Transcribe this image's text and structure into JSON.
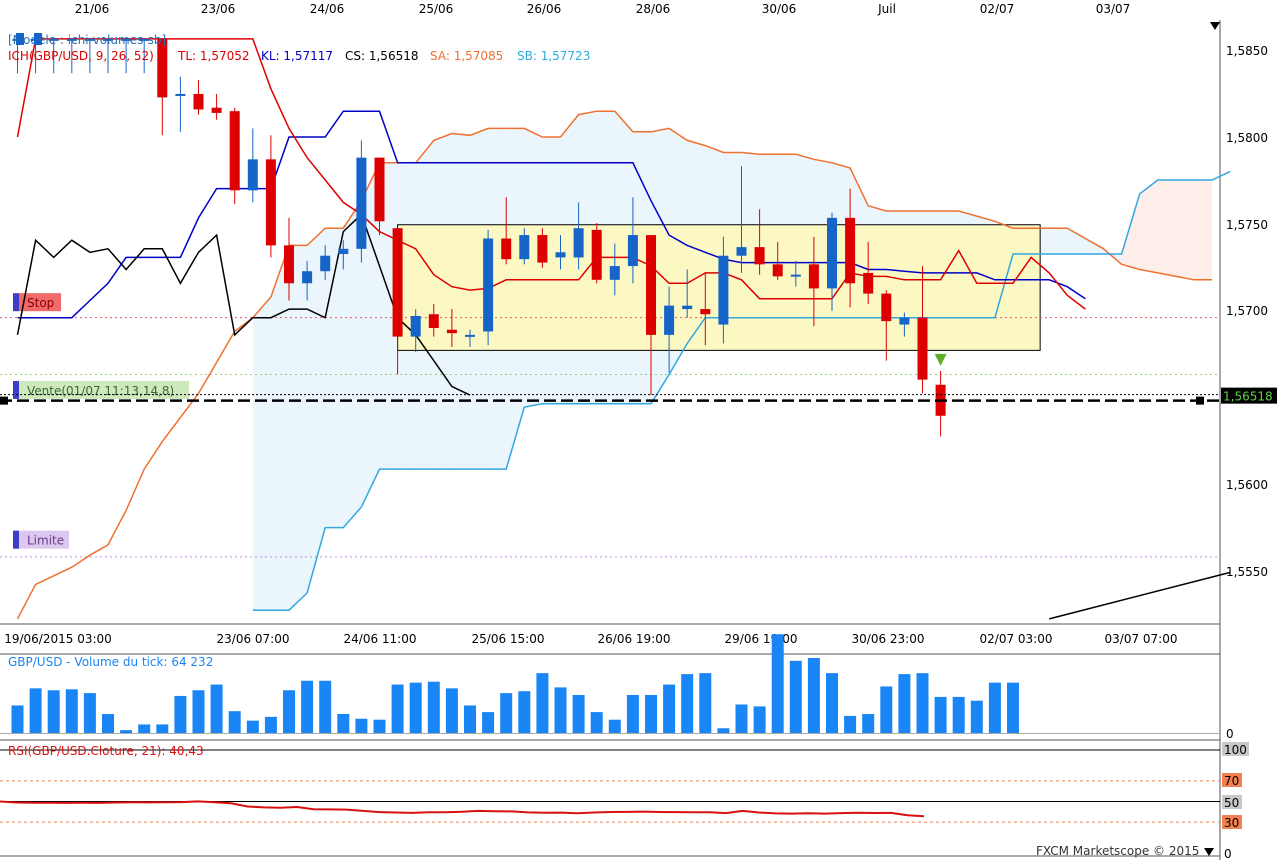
{
  "chart_data": {
    "type": "candlestick",
    "symbol": "GBP/USD",
    "top_dates": [
      "21/06",
      "23/06",
      "24/06",
      "25/06",
      "26/06",
      "28/06",
      "30/06",
      "Juil",
      "02/07",
      "03/07"
    ],
    "bottom_dates": [
      "19/06/2015 03:00",
      "23/06 07:00",
      "24/06 11:00",
      "25/06 15:00",
      "26/06 19:00",
      "29/06 19:00",
      "30/06 23:00",
      "02/07 03:00",
      "03/07 07:00"
    ],
    "price_ticks": [
      "1,5850",
      "1,5800",
      "1,5750",
      "1,5700",
      "1,5600",
      "1,5550"
    ],
    "ylim": [
      1.5522,
      1.5866
    ],
    "current_price": "1,56518",
    "current_price_value": 1.56518,
    "model_label": "[Modèle : ichi-volumes-sb]",
    "ichimoku": {
      "header": "ICH(GBP/USD, 9, 26, 52)",
      "tl": "TL: 1,57052",
      "kl": "KL: 1,57117",
      "cs": "CS: 1,56518",
      "sa": "SA: 1,57085",
      "sb": "SB: 1,57723",
      "tenkan": [
        1.5805,
        1.5862,
        1.5862,
        1.5862,
        1.5862,
        1.5862,
        1.5862,
        1.5862,
        1.5862,
        1.5862,
        1.5862,
        1.5862,
        1.5862,
        1.5862,
        1.5833,
        1.581,
        1.5793,
        1.578,
        1.5767,
        1.576,
        1.575,
        1.5745,
        1.574,
        1.5725,
        1.5718,
        1.5716,
        1.5717,
        1.5722,
        1.5722,
        1.5722,
        1.5722,
        1.5722,
        1.5735,
        1.5735,
        1.5735,
        1.573,
        1.572,
        1.572,
        1.5726,
        1.5726,
        1.5722,
        1.5711,
        1.5711,
        1.5711,
        1.5711,
        1.5711,
        1.5726,
        1.5724,
        1.5724,
        1.5722,
        1.5722,
        1.5722,
        1.5739,
        1.572,
        1.572,
        1.572,
        1.5735,
        1.5726,
        1.5713,
        1.5705
      ],
      "kijun": [
        1.57,
        1.57,
        1.57,
        1.57,
        1.571,
        1.572,
        1.5735,
        1.5735,
        1.5735,
        1.5735,
        1.5758,
        1.5775,
        1.5775,
        1.5775,
        1.5775,
        1.5805,
        1.5805,
        1.5805,
        1.582,
        1.582,
        1.582,
        1.579,
        1.579,
        1.579,
        1.579,
        1.579,
        1.579,
        1.579,
        1.579,
        1.579,
        1.579,
        1.579,
        1.579,
        1.579,
        1.579,
        1.5768,
        1.5748,
        1.5742,
        1.5738,
        1.5734,
        1.5732,
        1.5732,
        1.5732,
        1.5732,
        1.5732,
        1.5732,
        1.5732,
        1.5728,
        1.5728,
        1.5727,
        1.5726,
        1.5726,
        1.5726,
        1.5726,
        1.5722,
        1.5722,
        1.5722,
        1.5722,
        1.5718,
        1.5711
      ],
      "chikou": [
        1.569,
        1.5745,
        1.5735,
        1.5745,
        1.5738,
        1.574,
        1.5728,
        1.574,
        1.574,
        1.572,
        1.5738,
        1.5748,
        1.569,
        1.57,
        1.57,
        1.5705,
        1.5705,
        1.57,
        1.575,
        1.576,
        1.573,
        1.57,
        1.569,
        1.5675,
        1.566,
        1.5655
      ],
      "senkou_a": [
        1.5525,
        1.5545,
        1.555,
        1.5555,
        1.5562,
        1.5568,
        1.5588,
        1.5612,
        1.5628,
        1.5642,
        1.5656,
        1.5674,
        1.5692,
        1.57,
        1.5712,
        1.5742,
        1.5742,
        1.5752,
        1.5752,
        1.5768,
        1.579,
        1.579,
        1.579,
        1.5803,
        1.5807,
        1.5806,
        1.581,
        1.581,
        1.581,
        1.5805,
        1.5805,
        1.5818,
        1.582,
        1.582,
        1.5808,
        1.5808,
        1.581,
        1.5803,
        1.58,
        1.5796,
        1.5796,
        1.5795,
        1.5795,
        1.5795,
        1.5792,
        1.579,
        1.5787,
        1.5765,
        1.5762,
        1.5762,
        1.5762,
        1.5762,
        1.5762,
        1.5759,
        1.5756,
        1.5752,
        1.5752,
        1.5752,
        1.5752,
        1.5746,
        1.574,
        1.5731,
        1.5728,
        1.5726,
        1.5724,
        1.5722,
        1.5722
      ],
      "senkou_b": [
        1.553,
        1.553,
        1.553,
        1.554,
        1.5578,
        1.5578,
        1.559,
        1.5612,
        1.5612,
        1.5612,
        1.5612,
        1.5612,
        1.5612,
        1.5612,
        1.5612,
        1.5648,
        1.565,
        1.565,
        1.565,
        1.565,
        1.565,
        1.565,
        1.565,
        1.5667,
        1.5685,
        1.57,
        1.57,
        1.57,
        1.57,
        1.57,
        1.57,
        1.57,
        1.57,
        1.57,
        1.57,
        1.57,
        1.57,
        1.57,
        1.57,
        1.57,
        1.57,
        1.57,
        1.5737,
        1.5737,
        1.5737,
        1.5737,
        1.5737,
        1.5737,
        1.5737,
        1.5772,
        1.578,
        1.578,
        1.578,
        1.578,
        1.5785
      ]
    },
    "candles": [
      {
        "o": 1.5862,
        "h": 1.5862,
        "l": 1.5842,
        "c": 1.5862
      },
      {
        "o": 1.5862,
        "h": 1.5862,
        "l": 1.5842,
        "c": 1.5862
      },
      {
        "o": 1.5862,
        "h": 1.5862,
        "l": 1.5842,
        "c": 1.5862
      },
      {
        "o": 1.5862,
        "h": 1.5862,
        "l": 1.5842,
        "c": 1.5862
      },
      {
        "o": 1.5862,
        "h": 1.5862,
        "l": 1.5842,
        "c": 1.5862
      },
      {
        "o": 1.5862,
        "h": 1.5862,
        "l": 1.5842,
        "c": 1.5862
      },
      {
        "o": 1.5862,
        "h": 1.5862,
        "l": 1.5842,
        "c": 1.5862
      },
      {
        "o": 1.5862,
        "h": 1.5862,
        "l": 1.5842,
        "c": 1.5862
      },
      {
        "o": 1.5862,
        "h": 1.5862,
        "l": 1.5806,
        "c": 1.5828
      },
      {
        "o": 1.5829,
        "h": 1.584,
        "l": 1.5808,
        "c": 1.583
      },
      {
        "o": 1.583,
        "h": 1.5838,
        "l": 1.5818,
        "c": 1.5821
      },
      {
        "o": 1.5822,
        "h": 1.583,
        "l": 1.5815,
        "c": 1.5819
      },
      {
        "o": 1.582,
        "h": 1.5822,
        "l": 1.5766,
        "c": 1.5774
      },
      {
        "o": 1.5774,
        "h": 1.581,
        "l": 1.5767,
        "c": 1.5792
      },
      {
        "o": 1.5792,
        "h": 1.5806,
        "l": 1.5735,
        "c": 1.5742
      },
      {
        "o": 1.5742,
        "h": 1.5758,
        "l": 1.571,
        "c": 1.572
      },
      {
        "o": 1.572,
        "h": 1.5733,
        "l": 1.571,
        "c": 1.5727
      },
      {
        "o": 1.5727,
        "h": 1.5742,
        "l": 1.5722,
        "c": 1.5736
      },
      {
        "o": 1.5737,
        "h": 1.5745,
        "l": 1.5728,
        "c": 1.574
      },
      {
        "o": 1.574,
        "h": 1.5803,
        "l": 1.5732,
        "c": 1.5793
      },
      {
        "o": 1.5793,
        "h": 1.5793,
        "l": 1.5748,
        "c": 1.5756
      },
      {
        "o": 1.5752,
        "h": 1.5752,
        "l": 1.5667,
        "c": 1.5689
      },
      {
        "o": 1.5689,
        "h": 1.5705,
        "l": 1.568,
        "c": 1.5701
      },
      {
        "o": 1.5702,
        "h": 1.5708,
        "l": 1.5689,
        "c": 1.5694
      },
      {
        "o": 1.5693,
        "h": 1.5705,
        "l": 1.5683,
        "c": 1.5691
      },
      {
        "o": 1.569,
        "h": 1.5693,
        "l": 1.5683,
        "c": 1.569
      },
      {
        "o": 1.5692,
        "h": 1.5751,
        "l": 1.5684,
        "c": 1.5746
      },
      {
        "o": 1.5746,
        "h": 1.577,
        "l": 1.5731,
        "c": 1.5734
      },
      {
        "o": 1.5734,
        "h": 1.5752,
        "l": 1.5731,
        "c": 1.5748
      },
      {
        "o": 1.5748,
        "h": 1.5752,
        "l": 1.5729,
        "c": 1.5732
      },
      {
        "o": 1.5735,
        "h": 1.5748,
        "l": 1.5728,
        "c": 1.5738
      },
      {
        "o": 1.5735,
        "h": 1.5767,
        "l": 1.5728,
        "c": 1.5752
      },
      {
        "o": 1.5751,
        "h": 1.5755,
        "l": 1.572,
        "c": 1.5722
      },
      {
        "o": 1.5722,
        "h": 1.5743,
        "l": 1.5713,
        "c": 1.573
      },
      {
        "o": 1.573,
        "h": 1.577,
        "l": 1.572,
        "c": 1.5748
      },
      {
        "o": 1.5748,
        "h": 1.5748,
        "l": 1.5655,
        "c": 1.569
      },
      {
        "o": 1.569,
        "h": 1.5718,
        "l": 1.5668,
        "c": 1.5707
      },
      {
        "o": 1.5705,
        "h": 1.5728,
        "l": 1.57,
        "c": 1.5707
      },
      {
        "o": 1.5705,
        "h": 1.5726,
        "l": 1.5684,
        "c": 1.5702
      },
      {
        "o": 1.5696,
        "h": 1.5747,
        "l": 1.5685,
        "c": 1.5736
      },
      {
        "o": 1.5736,
        "h": 1.5788,
        "l": 1.5726,
        "c": 1.5741
      },
      {
        "o": 1.5741,
        "h": 1.5763,
        "l": 1.5725,
        "c": 1.5731
      },
      {
        "o": 1.5731,
        "h": 1.5744,
        "l": 1.5722,
        "c": 1.5724
      },
      {
        "o": 1.5724,
        "h": 1.5733,
        "l": 1.5718,
        "c": 1.5725
      },
      {
        "o": 1.5731,
        "h": 1.5747,
        "l": 1.5695,
        "c": 1.5717
      },
      {
        "o": 1.5717,
        "h": 1.5761,
        "l": 1.5704,
        "c": 1.5758
      },
      {
        "o": 1.5758,
        "h": 1.5775,
        "l": 1.5706,
        "c": 1.572
      },
      {
        "o": 1.5726,
        "h": 1.5744,
        "l": 1.5708,
        "c": 1.5714
      },
      {
        "o": 1.5714,
        "h": 1.5716,
        "l": 1.5675,
        "c": 1.5698
      },
      {
        "o": 1.5696,
        "h": 1.5703,
        "l": 1.5689,
        "c": 1.57
      },
      {
        "o": 1.57,
        "h": 1.573,
        "l": 1.5656,
        "c": 1.5664
      },
      {
        "o": 1.5661,
        "h": 1.5669,
        "l": 1.5631,
        "c": 1.5643
      }
    ],
    "trade_box": {
      "x_start": 21,
      "x_end": 56.5,
      "y_top": 1.5754,
      "y_bottom": 1.5681
    },
    "stop_level": 1.57,
    "stop_label": "Stop",
    "sell_level": 1.5667,
    "sell_label": "Vente(01/07 11:13,14,8)",
    "limit_level": 1.5561,
    "limit_label": "Limite",
    "trend_line": {
      "x1": 57,
      "y1": 1.5525,
      "x2": 67,
      "y2": 1.5552
    },
    "volume": {
      "title": "GBP/USD - Volume du tick: 64 232",
      "zero_label": "0",
      "max": 80,
      "values": [
        29,
        47,
        45,
        46,
        42,
        20,
        3,
        9,
        9,
        39,
        45,
        51,
        23,
        13,
        17,
        45,
        55,
        55,
        20,
        15,
        14,
        51,
        53,
        54,
        47,
        29,
        22,
        42,
        44,
        63,
        48,
        40,
        22,
        14,
        40,
        40,
        51,
        62,
        63,
        5,
        30,
        28,
        104,
        76,
        79,
        63,
        18,
        20,
        49,
        62,
        63,
        38,
        38,
        34,
        53,
        53
      ]
    },
    "rsi": {
      "title": "RSI(GBP/USD.Cloture, 21): 40,43",
      "levels": [
        "100",
        "70",
        "50",
        "30",
        "0"
      ],
      "ylim": [
        0,
        100
      ],
      "values": [
        50.0,
        49.0,
        48.7,
        48.7,
        48.6,
        48.7,
        48.6,
        49.0,
        49.2,
        49.1,
        49.2,
        49.4,
        50.1,
        49.3,
        48.3,
        45.1,
        44.3,
        43.9,
        44.7,
        42.5,
        42.3,
        42.1,
        40.9,
        39.7,
        39.3,
        38.9,
        39.6,
        39.5,
        40.0,
        40.9,
        40.6,
        40.4,
        39.4,
        39.0,
        39.2,
        38.5,
        39.3,
        39.8,
        39.9,
        40.2,
        39.8,
        39.7,
        39.5,
        39.5,
        38.7,
        40.9,
        39.3,
        38.4,
        38.3,
        38.6,
        38.3,
        38.7,
        39.0,
        38.8,
        38.9,
        36.7,
        35.6
      ]
    },
    "colors": {
      "bull": "#1565c8",
      "bear": "#dd0000",
      "tenkan": "#e00000",
      "kijun": "#0000c8",
      "chikou": "#000000",
      "senkou_a": "#f07030",
      "senkou_b": "#30a8e0",
      "cloud_up": "#eaf5fc",
      "cloud_down": "#fdeeea",
      "volume": "#1a86f5",
      "rsi": "#d81010",
      "box_fill": "#fbf8c4",
      "price_tag": "#2e7d1a"
    },
    "footer": "FXCM Marketscope © 2015"
  }
}
